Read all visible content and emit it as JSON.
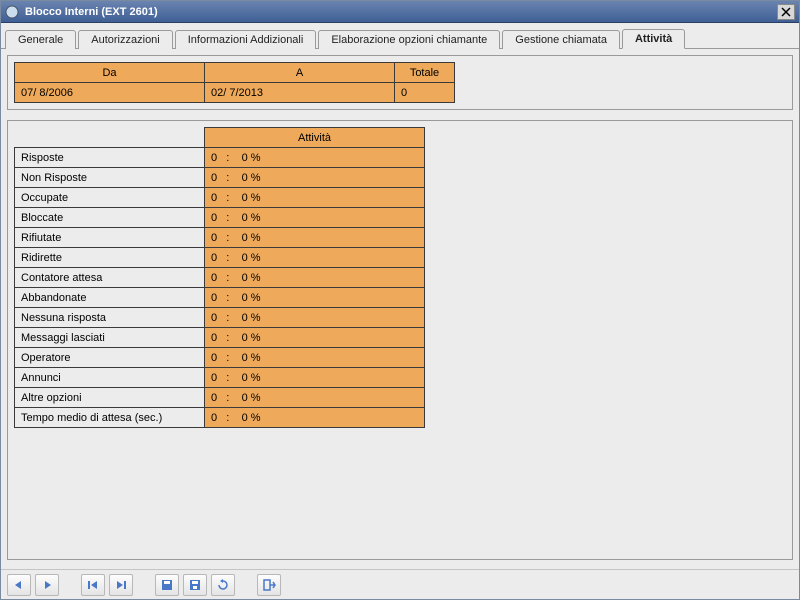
{
  "window": {
    "title": "Blocco Interni (EXT 2601)"
  },
  "tabs": [
    {
      "label": "Generale"
    },
    {
      "label": "Autorizzazioni"
    },
    {
      "label": "Informazioni Addizionali"
    },
    {
      "label": "Elaborazione opzioni chiamante"
    },
    {
      "label": "Gestione chiamata"
    },
    {
      "label": "Attività"
    }
  ],
  "active_tab_index": 5,
  "date_panel": {
    "headers": {
      "from": "Da",
      "to": "A",
      "total": "Totale"
    },
    "values": {
      "from": "07/ 8/2006",
      "to": "02/ 7/2013",
      "total": "0"
    }
  },
  "activity_panel": {
    "header": "Attività",
    "rows": [
      {
        "label": "Risposte",
        "value": "0   :    0 %"
      },
      {
        "label": "Non Risposte",
        "value": "0   :    0 %"
      },
      {
        "label": "Occupate",
        "value": "0   :    0 %"
      },
      {
        "label": "Bloccate",
        "value": "0   :    0 %"
      },
      {
        "label": "Rifiutate",
        "value": "0   :    0 %"
      },
      {
        "label": "Ridirette",
        "value": "0   :    0 %"
      },
      {
        "label": "Contatore attesa",
        "value": "0   :    0 %"
      },
      {
        "label": "Abbandonate",
        "value": "0   :    0 %"
      },
      {
        "label": "Nessuna risposta",
        "value": "0   :    0 %"
      },
      {
        "label": "Messaggi lasciati",
        "value": "0   :    0 %"
      },
      {
        "label": "Operatore",
        "value": "0   :    0 %"
      },
      {
        "label": "Annunci",
        "value": "0   :    0 %"
      },
      {
        "label": "Altre opzioni",
        "value": "0   :    0 %"
      },
      {
        "label": "Tempo medio di attesa (sec.)",
        "value": "0   :    0 %"
      }
    ]
  },
  "toolbar": {
    "buttons": [
      "prev",
      "next",
      "first",
      "last",
      "save",
      "save-as",
      "refresh",
      "exit"
    ]
  }
}
